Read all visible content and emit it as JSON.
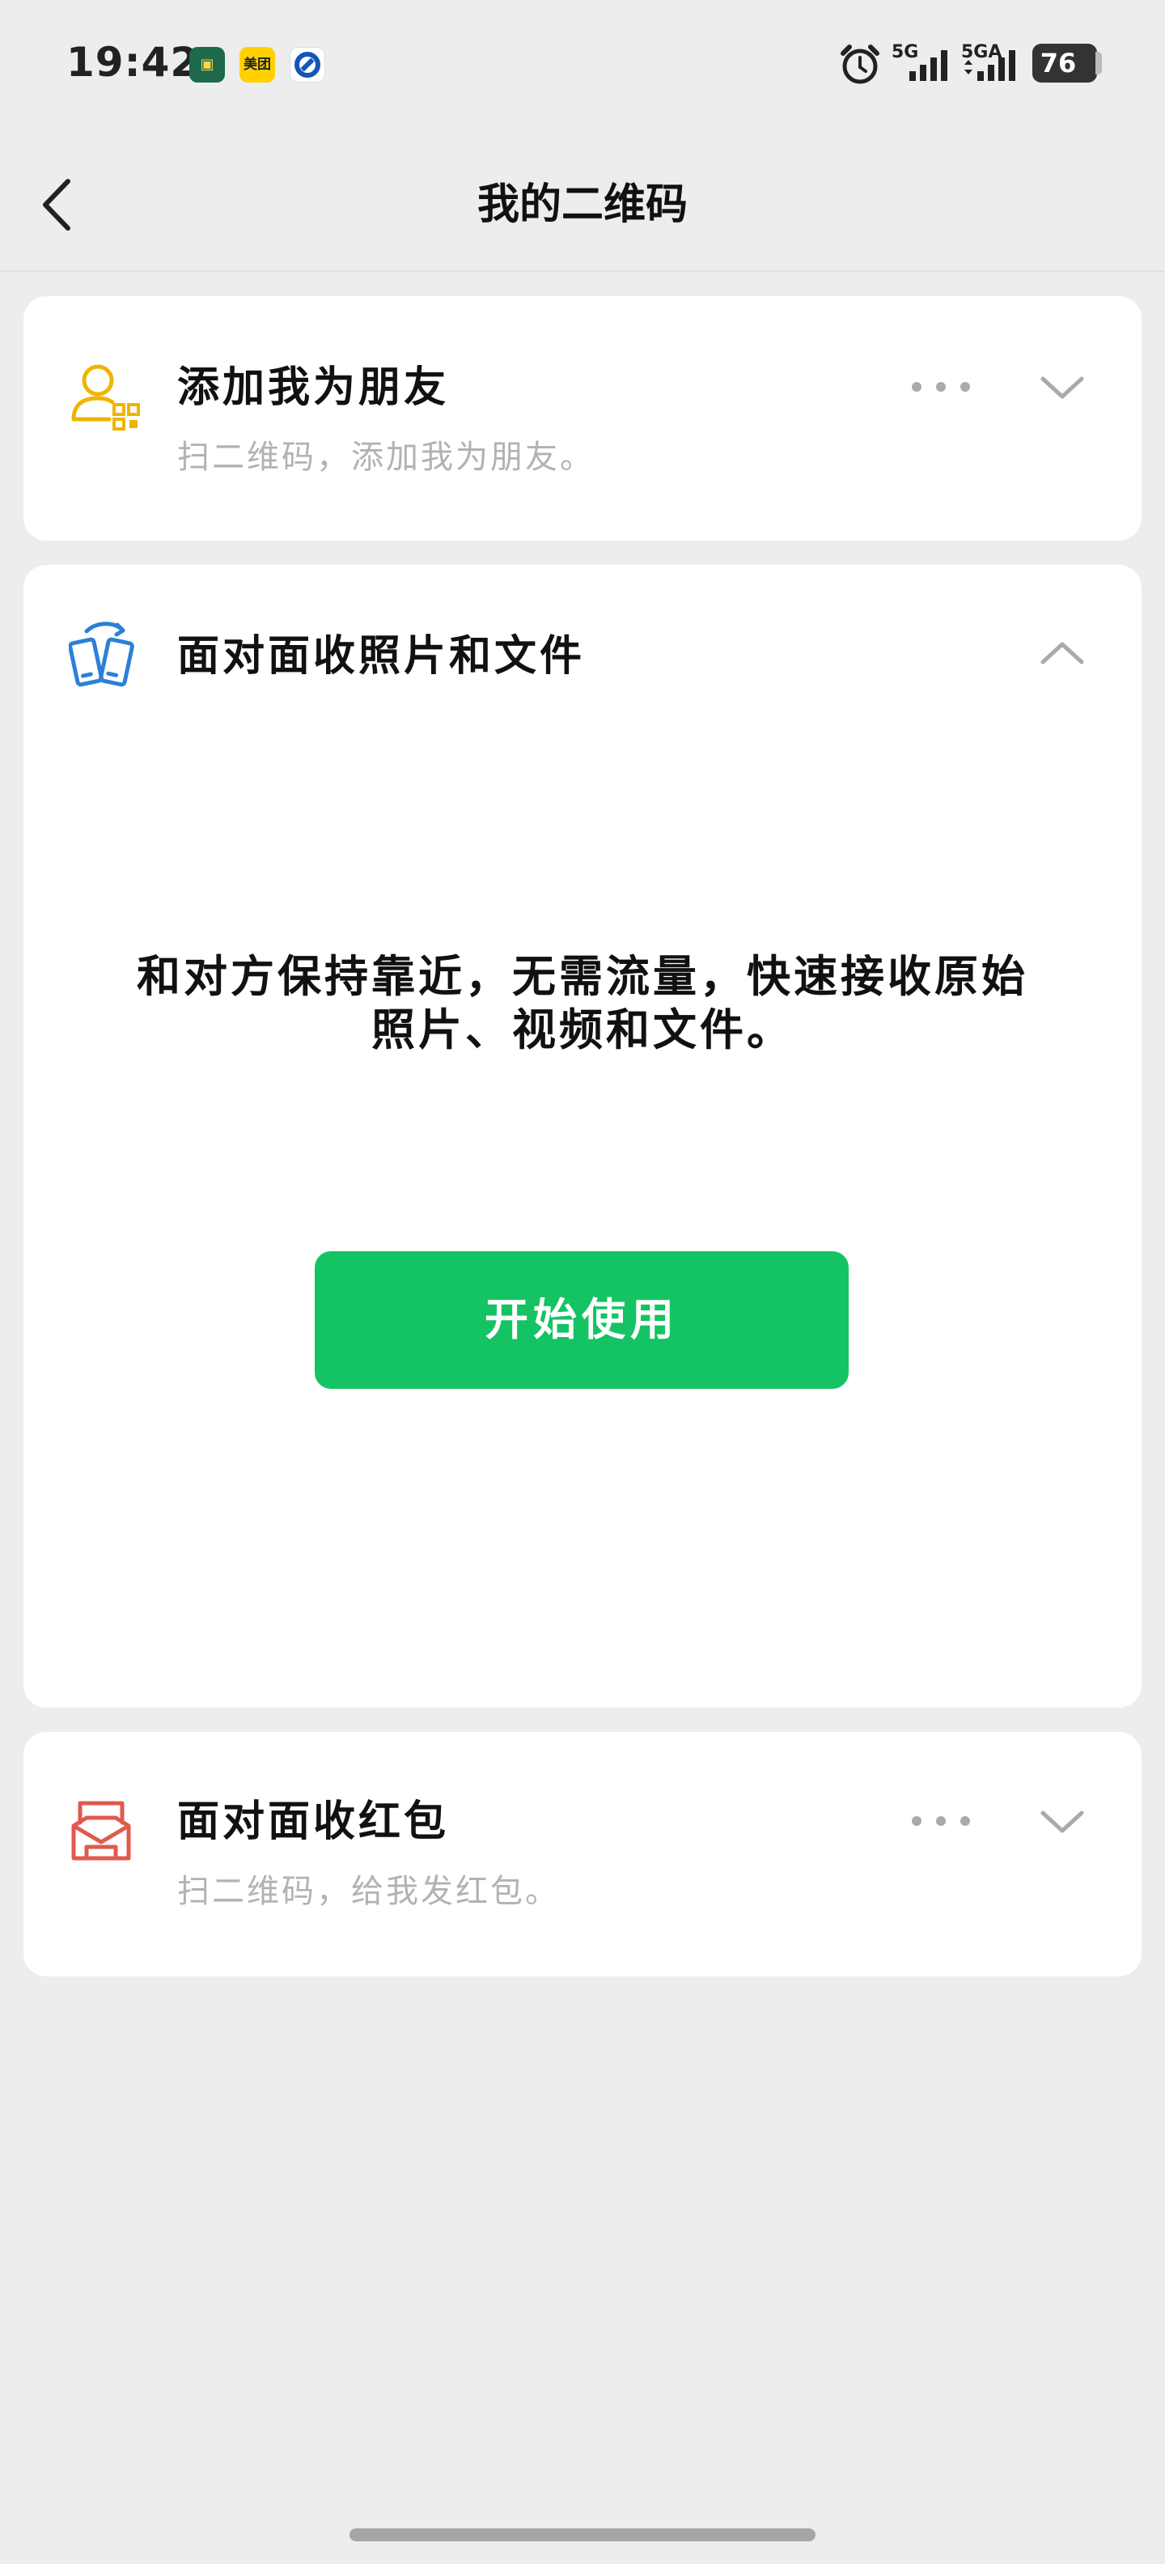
{
  "status_bar": {
    "time": "19:42",
    "app_icons": [
      "dianping-icon",
      "meituan-icon",
      "bank-icon"
    ],
    "meituan_label": "美团",
    "network_1": "5G",
    "network_2": "5GA",
    "battery": "76"
  },
  "nav": {
    "title": "我的二维码",
    "back_icon": "chevron-left-icon"
  },
  "cards": {
    "add_friend": {
      "title": "添加我为朋友",
      "subtitle": "扫二维码，添加我为朋友。",
      "icon": "person-qr-icon",
      "icon_color": "#f0b400"
    },
    "receive_files": {
      "title": "面对面收照片和文件",
      "icon": "phones-transfer-icon",
      "icon_color": "#2b80d8",
      "description_line1": "和对方保持靠近，无需流量，快速接收原始",
      "description_line2": "照片、视频和文件。",
      "button_label": "开始使用"
    },
    "red_packet": {
      "title": "面对面收红包",
      "subtitle": "扫二维码，给我发红包。",
      "icon": "red-packet-icon",
      "icon_color": "#e05a4e"
    }
  },
  "colors": {
    "accent": "#14c363",
    "background": "#ededed",
    "card": "#ffffff"
  }
}
